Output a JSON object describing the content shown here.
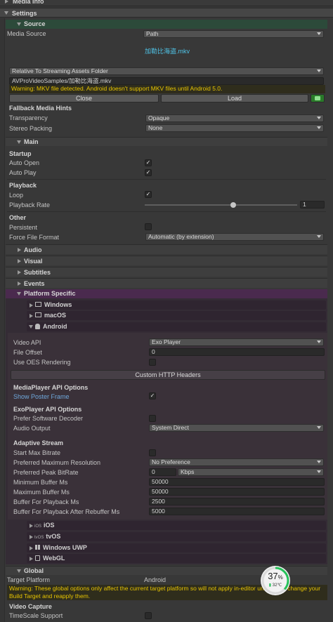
{
  "top": {
    "media_info": "Media Info",
    "settings": "Settings"
  },
  "source": {
    "section": "Source",
    "media_source_label": "Media Source",
    "media_source_value": "Path",
    "file_title": "加勒比海盗.mkv",
    "path_base": "Relative To Streaming Assets Folder",
    "path_value": "AVProVideoSamples/加勒比海盗.mkv",
    "warning": "Warning: MKV file detected. Android doesn't support MKV files until Android 5.0.",
    "close_label": "Close",
    "load_label": "Load",
    "fallback_header": "Fallback Media Hints",
    "transparency_label": "Transparency",
    "transparency_value": "Opaque",
    "stereo_label": "Stereo Packing",
    "stereo_value": "None"
  },
  "main": {
    "section": "Main",
    "startup_header": "Startup",
    "auto_open_label": "Auto Open",
    "auto_open": true,
    "auto_play_label": "Auto Play",
    "auto_play": true,
    "playback_header": "Playback",
    "loop_label": "Loop",
    "loop": true,
    "rate_label": "Playback Rate",
    "rate_value": "1",
    "rate_fraction": 0.58,
    "other_header": "Other",
    "persistent_label": "Persistent",
    "persistent": false,
    "force_format_label": "Force File Format",
    "force_format_value": "Automatic (by extension)"
  },
  "sections": {
    "audio": "Audio",
    "visual": "Visual",
    "subtitles": "Subtitles",
    "events": "Events",
    "platform": "Platform Specific"
  },
  "platforms": {
    "windows": "Windows",
    "macos": "macOS",
    "android": "Android",
    "ios": "iOS",
    "tvos": "tvOS",
    "uwp": "Windows UWP",
    "webgl": "WebGL",
    "ios_small": "iOS",
    "tvos_small": "tvOS"
  },
  "android": {
    "video_api_label": "Video API",
    "video_api_value": "Exo Player",
    "file_offset_label": "File Offset",
    "file_offset_value": "0",
    "oes_label": "Use OES Rendering",
    "oes": false,
    "custom_headers": "Custom HTTP Headers",
    "mp_api_header": "MediaPlayer API Options",
    "poster_label": "Show Poster Frame",
    "poster": true,
    "exo_header": "ExoPlayer API Options",
    "soft_dec_label": "Prefer Software Decoder",
    "soft_dec": false,
    "audio_out_label": "Audio Output",
    "audio_out_value": "System Direct",
    "adaptive_header": "Adaptive Stream",
    "start_max_label": "Start Max Bitrate",
    "start_max": false,
    "pref_res_label": "Preferred Maximum Resolution",
    "pref_res_value": "No Preference",
    "peak_label": "Preferred Peak BitRate",
    "peak_value": "0",
    "peak_unit": "Kbps",
    "min_buf_label": "Minimum Buffer Ms",
    "min_buf_value": "50000",
    "max_buf_label": "Maximum Buffer Ms",
    "max_buf_value": "50000",
    "buf_play_label": "Buffer For Playback Ms",
    "buf_play_value": "2500",
    "buf_rebuf_label": "Buffer For Playback After Rebuffer Ms",
    "buf_rebuf_value": "5000"
  },
  "global": {
    "section": "Global",
    "target_label": "Target Platform",
    "target_value": "Android",
    "warning": "Warning: These global options only affect the current target platform so will not apply in-editor unless you change your Build Target and reapply them.",
    "video_capture_header": "Video Capture",
    "timescale_label": "TimeScale Support",
    "timescale": false
  },
  "overlay": {
    "percent": "37",
    "percent_sign": "%",
    "temp": "32℃",
    "fraction": 0.37
  },
  "colors": {
    "source_bar": "#2c4a3a",
    "platform_bar": "#4a2a4e",
    "warning": "#e7c400",
    "poster_label": "#6fa8dc",
    "ring": "#27c25a",
    "load_icon_bg": "#2a7a2a"
  }
}
